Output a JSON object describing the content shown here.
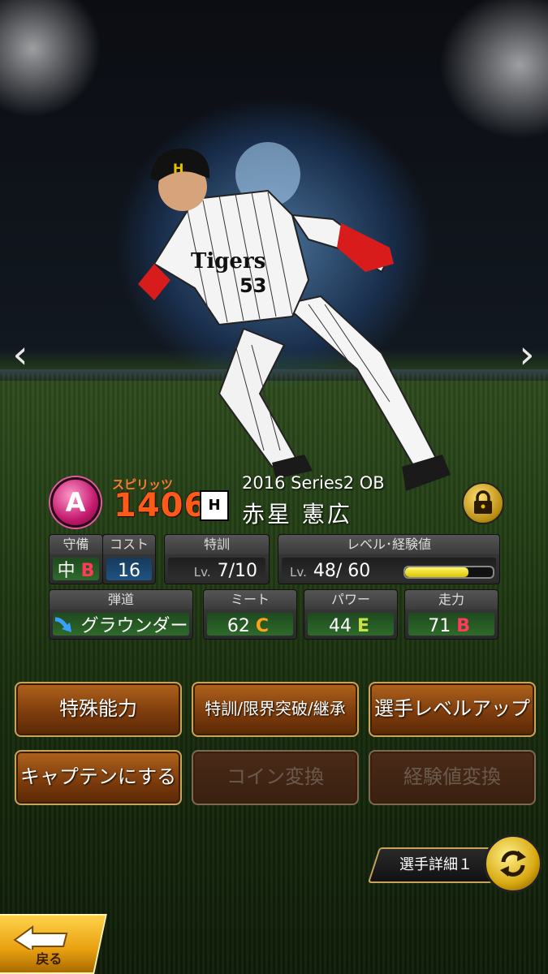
{
  "nav": {
    "prev_arrow": "‹",
    "next_arrow": "›"
  },
  "player_card": {
    "rank": "A",
    "spirits_label": "スピリッツ",
    "spirits_value": "1406",
    "team_logo_text": "H",
    "series": "2016 Series2 OB",
    "name": "赤星 憲広",
    "jersey_number": "53",
    "jersey_text": "Tigers"
  },
  "stats": {
    "position": {
      "label": "守備",
      "value": "中",
      "grade": "B"
    },
    "cost": {
      "label": "コスト",
      "value": "16"
    },
    "special_training": {
      "label": "特訓",
      "lv_prefix": "Lv.",
      "value": "7/10"
    },
    "level": {
      "label": "レベル･経験値",
      "lv_prefix": "Lv.",
      "value": "48/ 60",
      "xp_fill": 0.72
    },
    "trajectory": {
      "label": "弾道",
      "value": "グラウンダー"
    },
    "contact": {
      "label": "ミート",
      "value": "62",
      "grade": "C"
    },
    "power": {
      "label": "パワー",
      "value": "44",
      "grade": "E"
    },
    "speed": {
      "label": "走力",
      "value": "71",
      "grade": "B"
    }
  },
  "buttons": {
    "special_abilities": "特殊能力",
    "training_limit": "特訓/限界突破/継承",
    "level_up": "選手レベルアップ",
    "make_captain": "キャプテンにする",
    "coin_convert": "コイン変換",
    "xp_convert": "経験値変換"
  },
  "detail_tab": "選手詳細１",
  "back_label": "戻る",
  "colors": {
    "accent_orange": "#ff5a1a",
    "button_border": "#c9a35a",
    "rank_pink": "#c41a6e"
  },
  "icons": [
    "chevron-left-icon",
    "chevron-right-icon",
    "lock-icon",
    "swap-icon",
    "back-arrow-icon",
    "curve-arrow-icon"
  ]
}
